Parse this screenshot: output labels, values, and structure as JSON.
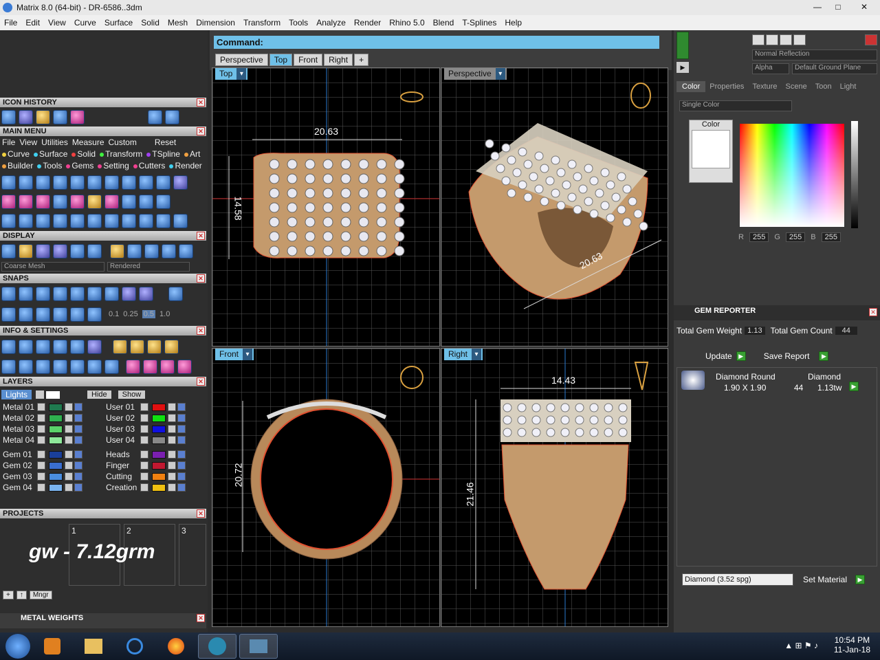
{
  "window": {
    "title": "Matrix 8.0 (64-bit) - DR-6586..3dm",
    "min": "—",
    "max": "□",
    "close": "✕"
  },
  "menu": [
    "File",
    "Edit",
    "View",
    "Curve",
    "Surface",
    "Solid",
    "Mesh",
    "Dimension",
    "Transform",
    "Tools",
    "Analyze",
    "Render",
    "Rhino 5.0",
    "Blend",
    "T-Splines",
    "Help"
  ],
  "left": {
    "icon_history": "ICON HISTORY",
    "main_menu": "MAIN MENU",
    "mm_top": [
      "File",
      "View",
      "Utilities",
      "Measure",
      "Custom"
    ],
    "reset": "Reset",
    "mm_row2": [
      "Curve",
      "Surface",
      "Solid",
      "Transform",
      "TSpline",
      "Art"
    ],
    "mm_row3": [
      "Builder",
      "Tools",
      "Gems",
      "Setting",
      "Cutters",
      "Render"
    ],
    "display": "DISPLAY",
    "coarse_mesh": "Coarse Mesh",
    "rendered": "Rendered",
    "snaps": "SNAPS",
    "snap_vals": [
      "0.1",
      "0.25",
      "0.5",
      "1.0"
    ],
    "info": "INFO & SETTINGS",
    "layers": "LAYERS",
    "lights": "Lights",
    "hide": "Hide",
    "show": "Show",
    "layers_left": [
      [
        "Metal 01",
        "#1f7a4f"
      ],
      [
        "Metal 02",
        "#2fb04f"
      ],
      [
        "Metal 03",
        "#5ad26a"
      ],
      [
        "Metal 04",
        "#8ee89a"
      ],
      [
        "Gem 01",
        "#1a3f9a"
      ],
      [
        "Gem 02",
        "#3a6ed0"
      ],
      [
        "Gem 03",
        "#4a8ee0"
      ],
      [
        "Gem 04",
        "#7ab4f0"
      ]
    ],
    "layers_right": [
      [
        "User 01",
        "#e01010"
      ],
      [
        "User 02",
        "#10e010"
      ],
      [
        "User 03",
        "#1010e0"
      ],
      [
        "User 04",
        "#888888"
      ],
      [
        "Heads",
        "#7a1fb0"
      ],
      [
        "Finger",
        "#c01830"
      ],
      [
        "Cutting",
        "#f08010"
      ],
      [
        "Creation",
        "#f0c010"
      ]
    ],
    "projects": "PROJECTS",
    "proj_nums": [
      "1",
      "2",
      "3"
    ],
    "gw": "gw - 7.12grm",
    "mngr": "Mngr",
    "metal_weights": "METAL WEIGHTS"
  },
  "command": {
    "label": "Command:"
  },
  "tabs": [
    "Perspective",
    "Top",
    "Front",
    "Right",
    "+"
  ],
  "viewports": {
    "top": {
      "label": "Top",
      "width": "20.63",
      "height": "14.58"
    },
    "perspective": {
      "label": "Perspective",
      "dim": "20.63"
    },
    "front": {
      "label": "Front",
      "dim": "20.72"
    },
    "right": {
      "label": "Right",
      "width": "14.43",
      "height": "21.46"
    }
  },
  "right": {
    "normal_reflection": "Normal Reflection",
    "alpha": "Alpha",
    "ground_plane": "Default Ground Plane",
    "tabs": [
      "Color",
      "Properties",
      "Texture",
      "Scene",
      "Toon",
      "Light"
    ],
    "single_color": "Single Color",
    "color_label": "Color",
    "r": "255",
    "g": "255",
    "b": "255",
    "rl": "R",
    "gl": "G",
    "bl": "B",
    "gem_reporter": "GEM REPORTER",
    "tgw_label": "Total Gem Weight",
    "tgw": "1.13",
    "tgc_label": "Total Gem Count",
    "tgc": "44",
    "update": "Update",
    "save_report": "Save Report",
    "gem_header": [
      "Diamond Round",
      "Diamond"
    ],
    "gem_row": [
      "1.90 X 1.90",
      "44",
      "1.13tw"
    ],
    "material": "Diamond      (3.52 spg)",
    "set_material": "Set Material"
  },
  "taskbar": {
    "time": "10:54 PM",
    "date": "11-Jan-18"
  }
}
